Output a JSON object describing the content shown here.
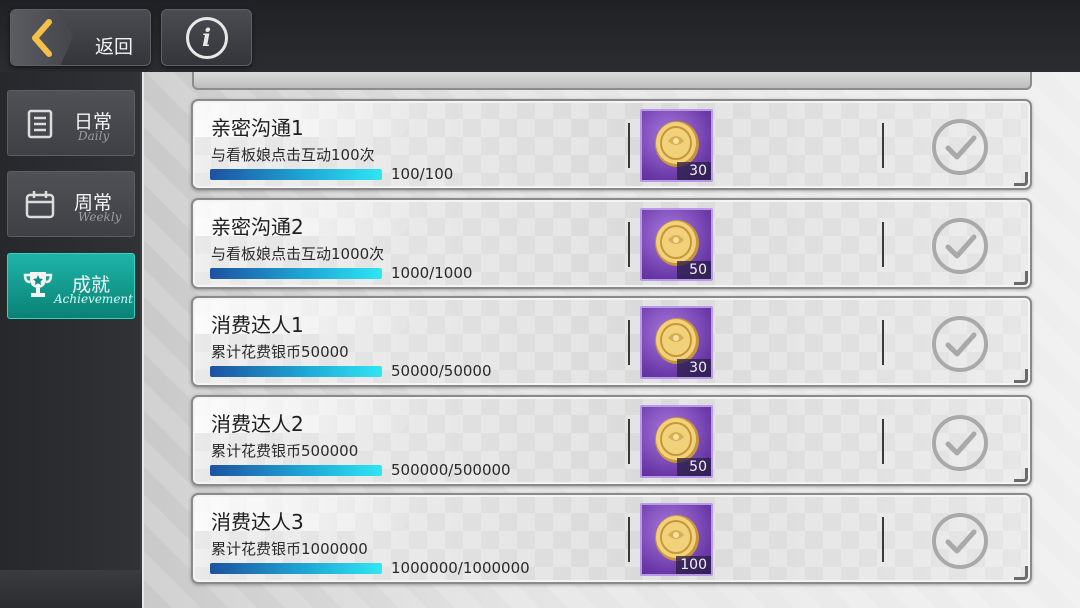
{
  "header": {
    "back_label": "返回",
    "info_symbol": "i"
  },
  "sidebar": {
    "tabs": [
      {
        "cn": "日常",
        "en": "Daily",
        "icon": "list-icon",
        "active": false
      },
      {
        "cn": "周常",
        "en": "Weekly",
        "icon": "calendar-icon",
        "active": false
      },
      {
        "cn": "成就",
        "en": "Achievement",
        "icon": "trophy-icon",
        "active": true
      }
    ]
  },
  "colors": {
    "accent": "#14a599",
    "reward_bg": "#7a44b8",
    "progress": "#1ea6d6"
  },
  "achievements": [
    {
      "title": "亲密沟通1",
      "desc": "与看板娘点击互动100次",
      "progress_text": "100/100",
      "progress": 1.0,
      "reward_icon": "silver-coin-icon",
      "reward_count": "30",
      "status": "completed"
    },
    {
      "title": "亲密沟通2",
      "desc": "与看板娘点击互动1000次",
      "progress_text": "1000/1000",
      "progress": 1.0,
      "reward_icon": "silver-coin-icon",
      "reward_count": "50",
      "status": "completed"
    },
    {
      "title": "消费达人1",
      "desc": "累计花费银币50000",
      "progress_text": "50000/50000",
      "progress": 1.0,
      "reward_icon": "silver-coin-icon",
      "reward_count": "30",
      "status": "completed"
    },
    {
      "title": "消费达人2",
      "desc": "累计花费银币500000",
      "progress_text": "500000/500000",
      "progress": 1.0,
      "reward_icon": "silver-coin-icon",
      "reward_count": "50",
      "status": "completed"
    },
    {
      "title": "消费达人3",
      "desc": "累计花费银币1000000",
      "progress_text": "1000000/1000000",
      "progress": 1.0,
      "reward_icon": "silver-coin-icon",
      "reward_count": "100",
      "status": "completed"
    }
  ]
}
